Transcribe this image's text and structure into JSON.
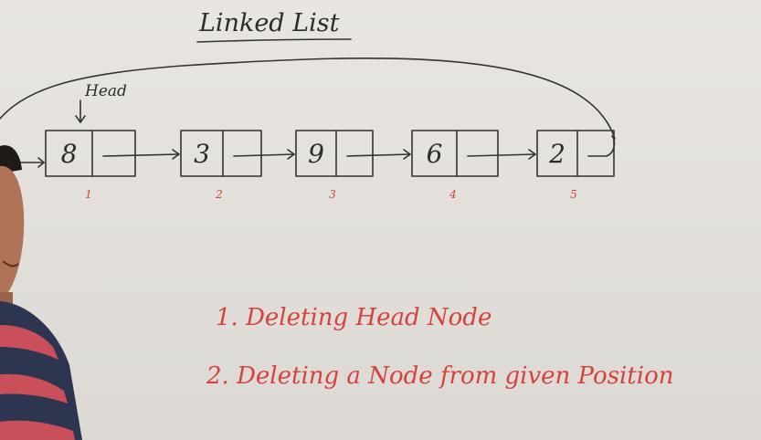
{
  "board": {
    "title": "Linked List",
    "head_label": "Head",
    "nodes": [
      {
        "value": "8",
        "position": "1"
      },
      {
        "value": "3",
        "position": "2"
      },
      {
        "value": "9",
        "position": "3"
      },
      {
        "value": "6",
        "position": "4"
      },
      {
        "value": "2",
        "position": "5"
      }
    ],
    "tasks": [
      "1. Deleting Head Node",
      "2. Deleting a Node from given Position"
    ]
  },
  "colors": {
    "board": "#e6e3de",
    "ink_black": "#333333",
    "ink_red": "#d8423d",
    "shirt_red": "#c9505a",
    "shirt_navy": "#2e3550",
    "skin": "#b07358"
  }
}
